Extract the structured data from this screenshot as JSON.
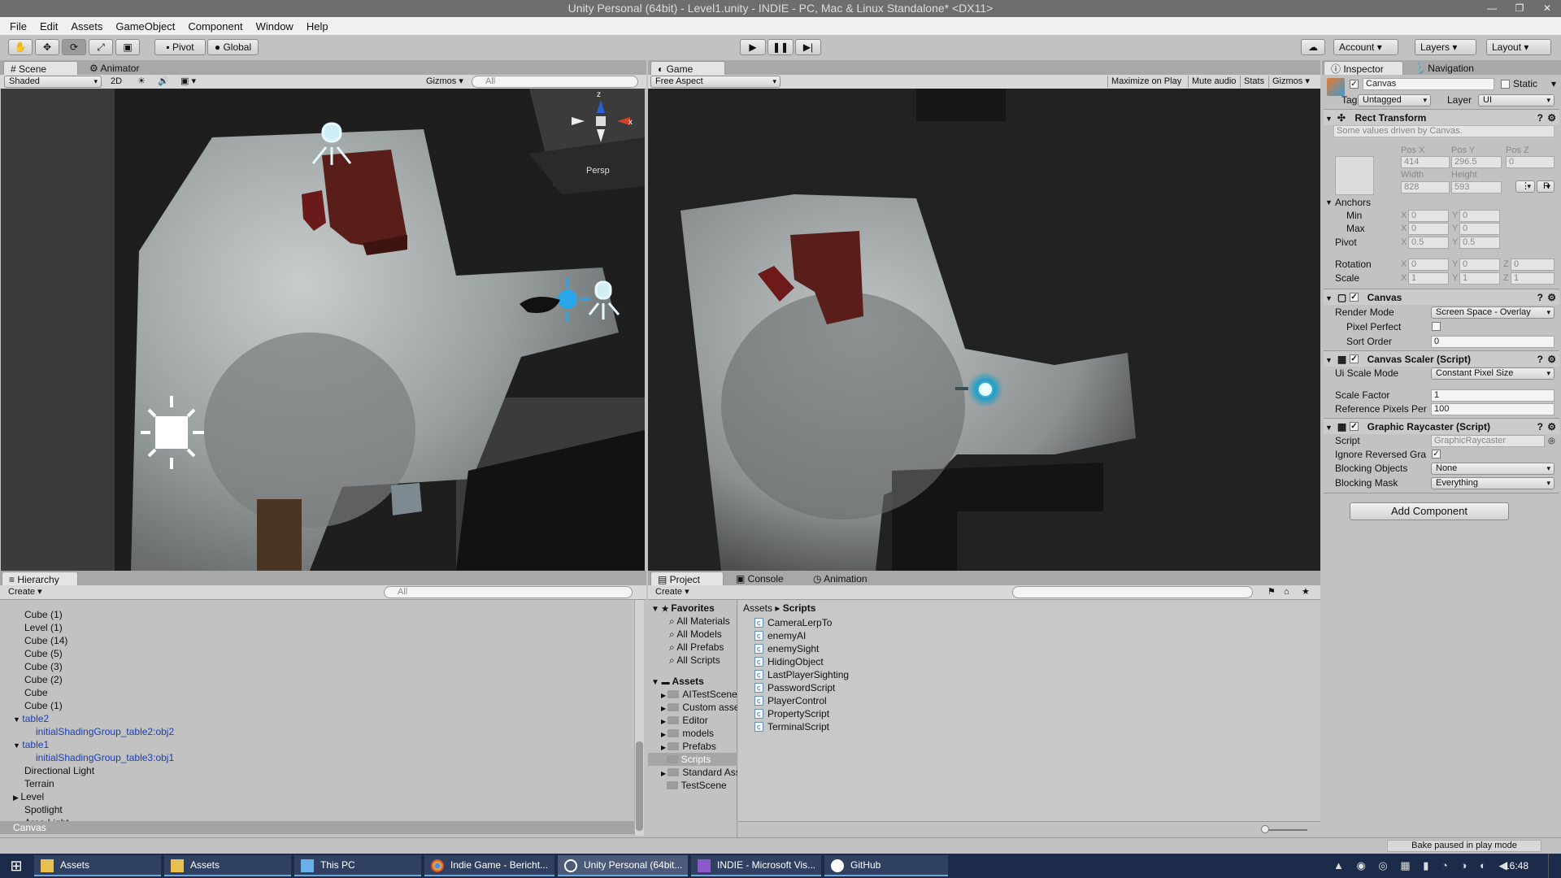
{
  "window": {
    "title": "Unity Personal (64bit) - Level1.unity - INDIE - PC, Mac & Linux Standalone* <DX11>"
  },
  "menu": [
    "File",
    "Edit",
    "Assets",
    "GameObject",
    "Component",
    "Window",
    "Help"
  ],
  "toolbar": {
    "pivot": "Pivot",
    "global": "Global",
    "account": "Account",
    "layers": "Layers",
    "layout": "Layout"
  },
  "scene_panel": {
    "tab_scene": "Scene",
    "tab_animator": "Animator",
    "shading": "Shaded",
    "mode_2d": "2D",
    "gizmos": "Gizmos",
    "search": "All",
    "persp": "Persp",
    "gizmo_x": "x",
    "gizmo_z": "z"
  },
  "game_panel": {
    "tab": "Game",
    "aspect": "Free Aspect",
    "maximize": "Maximize on Play",
    "mute": "Mute audio",
    "stats": "Stats",
    "gizmos": "Gizmos"
  },
  "hierarchy": {
    "tab": "Hierarchy",
    "create": "Create",
    "search": "All",
    "items": [
      {
        "label": "Cube (1)",
        "indent": 0,
        "blue": false,
        "arrow": ""
      },
      {
        "label": "Level (1)",
        "indent": 0,
        "blue": false,
        "arrow": ""
      },
      {
        "label": "Cube (14)",
        "indent": 0,
        "blue": false,
        "arrow": ""
      },
      {
        "label": "Cube (5)",
        "indent": 0,
        "blue": false,
        "arrow": ""
      },
      {
        "label": "Cube (3)",
        "indent": 0,
        "blue": false,
        "arrow": ""
      },
      {
        "label": "Cube (2)",
        "indent": 0,
        "blue": false,
        "arrow": ""
      },
      {
        "label": "Cube",
        "indent": 0,
        "blue": false,
        "arrow": ""
      },
      {
        "label": "Cube (1)",
        "indent": 0,
        "blue": false,
        "arrow": ""
      },
      {
        "label": "table2",
        "indent": 0,
        "blue": true,
        "arrow": "▼"
      },
      {
        "label": "initialShadingGroup_table2:obj2",
        "indent": 1,
        "blue": true,
        "arrow": ""
      },
      {
        "label": "table1",
        "indent": 0,
        "blue": true,
        "arrow": "▼"
      },
      {
        "label": "initialShadingGroup_table3:obj1",
        "indent": 1,
        "blue": true,
        "arrow": ""
      },
      {
        "label": "Directional Light",
        "indent": 0,
        "blue": false,
        "arrow": ""
      },
      {
        "label": "Terrain",
        "indent": 0,
        "blue": false,
        "arrow": ""
      },
      {
        "label": "Level",
        "indent": 0,
        "blue": false,
        "arrow": "▶"
      },
      {
        "label": "Spotlight",
        "indent": 0,
        "blue": false,
        "arrow": ""
      },
      {
        "label": "Area Light",
        "indent": 0,
        "blue": false,
        "arrow": ""
      }
    ],
    "selected": "Canvas"
  },
  "project": {
    "tab_project": "Project",
    "tab_console": "Console",
    "tab_animation": "Animation",
    "create": "Create",
    "favorites_label": "Favorites",
    "favorites": [
      "All Materials",
      "All Models",
      "All Prefabs",
      "All Scripts"
    ],
    "assets_label": "Assets",
    "folders": [
      "AITestScene",
      "Custom assets",
      "Editor",
      "models",
      "Prefabs",
      "Scripts",
      "Standard Assets",
      "TestScene"
    ],
    "breadcrumb_root": "Assets",
    "breadcrumb_current": "Scripts",
    "scripts": [
      "CameraLerpTo",
      "enemyAI",
      "enemySight",
      "HidingObject",
      "LastPlayerSighting",
      "PasswordScript",
      "PlayerControl",
      "PropertyScript",
      "TerminalScript"
    ]
  },
  "inspector": {
    "tab_inspector": "Inspector",
    "tab_navigation": "Navigation",
    "object_name": "Canvas",
    "static": "Static",
    "tag_label": "Tag",
    "tag_value": "Untagged",
    "layer_label": "Layer",
    "layer_value": "UI",
    "rect": {
      "title": "Rect Transform",
      "note": "Some values driven by Canvas.",
      "pos_x_label": "Pos X",
      "pos_y_label": "Pos Y",
      "pos_z_label": "Pos Z",
      "pos_x": "414",
      "pos_y": "296.5",
      "pos_z": "0",
      "width_label": "Width",
      "height_label": "Height",
      "width": "828",
      "height": "593",
      "anchors": "Anchors",
      "min": "Min",
      "max": "Max",
      "min_x": "0",
      "min_y": "0",
      "max_x": "0",
      "max_y": "0",
      "pivot": "Pivot",
      "pivot_x": "0.5",
      "pivot_y": "0.5",
      "rotation": "Rotation",
      "rot_x": "0",
      "rot_y": "0",
      "rot_z": "0",
      "scale": "Scale",
      "scale_x": "1",
      "scale_y": "1",
      "scale_z": "1",
      "r_btn": "R"
    },
    "canvas": {
      "title": "Canvas",
      "render_mode_label": "Render Mode",
      "render_mode": "Screen Space - Overlay",
      "pixel_perfect_label": "Pixel Perfect",
      "sort_order_label": "Sort Order",
      "sort_order": "0"
    },
    "scaler": {
      "title": "Canvas Scaler (Script)",
      "ui_scale_label": "Ui Scale Mode",
      "ui_scale": "Constant Pixel Size",
      "scale_factor_label": "Scale Factor",
      "scale_factor": "1",
      "ref_ppu_label": "Reference Pixels Per",
      "ref_ppu": "100"
    },
    "raycaster": {
      "title": "Graphic Raycaster (Script)",
      "script_label": "Script",
      "script": "GraphicRaycaster",
      "ignore_label": "Ignore Reversed Gra",
      "blocking_label": "Blocking Objects",
      "blocking": "None",
      "mask_label": "Blocking Mask",
      "mask": "Everything"
    },
    "add_component": "Add Component"
  },
  "status": {
    "bake": "Bake paused in play mode"
  },
  "taskbar": {
    "items": [
      "Assets",
      "Assets",
      "This PC",
      "Indie Game - Bericht...",
      "Unity Personal (64bit...",
      "INDIE - Microsoft Vis...",
      "GitHub"
    ],
    "clock": "16:48"
  },
  "colors": {
    "unity_bg": "#c2c2c2",
    "selection": "#3e7ad6",
    "blue_text": "#1a3fa8",
    "taskbar": "#1c2b4a"
  }
}
